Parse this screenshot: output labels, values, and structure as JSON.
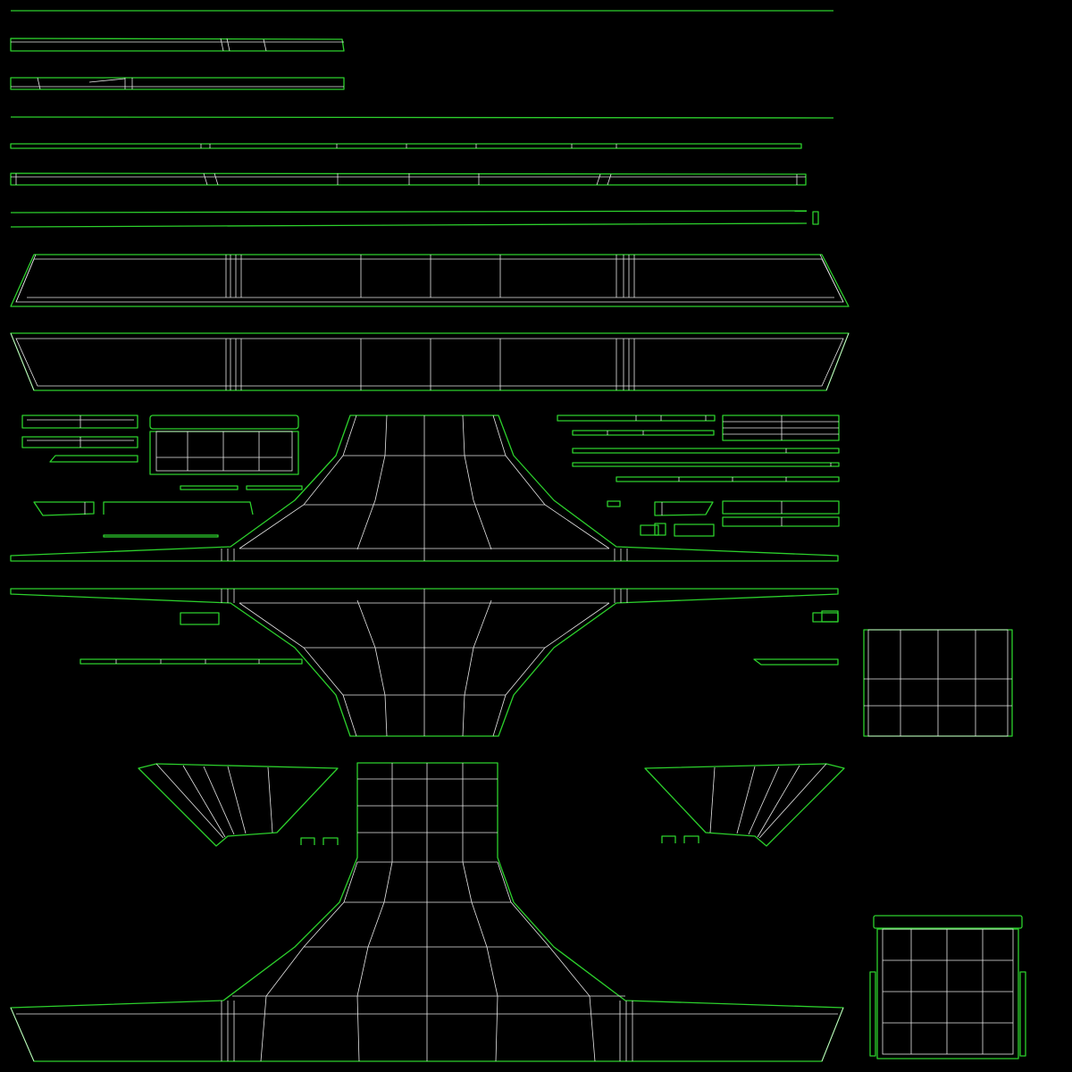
{
  "view": {
    "background": "#000000",
    "edge_color": "#2cd02c",
    "inner_edge_color": "#e6e6e6"
  }
}
